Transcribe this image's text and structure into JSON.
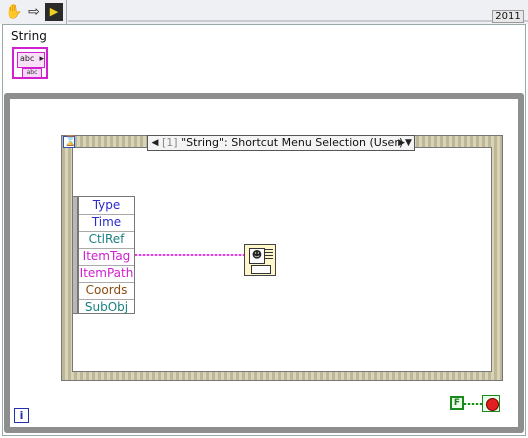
{
  "toolbar": {
    "year": "2011"
  },
  "front_label": "String",
  "string_terminal": {
    "inner_text": "abc",
    "tail_text": "abc"
  },
  "event_structure": {
    "selector_index": "[1]",
    "selector_text": "\"String\": Shortcut Menu Selection (User)",
    "timeout_glyph": "⌛"
  },
  "event_data_node": {
    "rows": [
      "Type",
      "Time",
      "CtlRef",
      "ItemTag",
      "ItemPath",
      "Coords",
      "SubObj"
    ]
  },
  "colors": {
    "type": "#2b2bcc",
    "time": "#2b2bcc",
    "ctlref": "#1a7f7f",
    "itemtag": "#d020d0",
    "itempath": "#d020d0",
    "coords": "#8a4a10",
    "subobj": "#1a7f7f"
  },
  "info_icon": "i",
  "false_constant": "F"
}
